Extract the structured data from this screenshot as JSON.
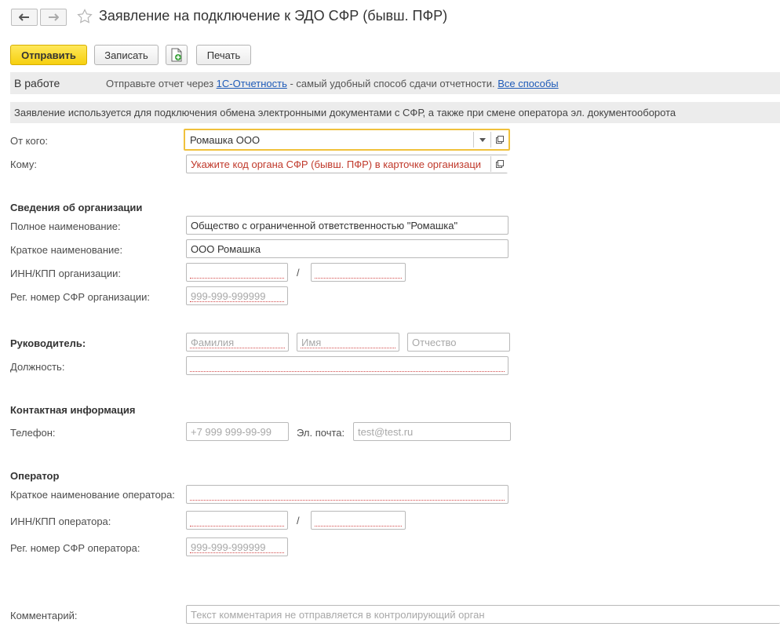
{
  "window": {
    "title": "Заявление на подключение к ЭДО СФР (бывш. ПФР)"
  },
  "toolbar": {
    "send_label": "Отправить",
    "save_label": "Записать",
    "print_label": "Печать"
  },
  "status": {
    "state": "В работе",
    "text_before": "Отправьте отчет через ",
    "link1": "1С-Отчетность",
    "text_after": " - самый удобный способ сдачи отчетности. ",
    "link2": "Все способы"
  },
  "info_text": "Заявление используется для подключения обмена электронными документами с СФР, а также при смене оператора эл. документооборота",
  "from": {
    "label": "От кого:",
    "value": "Ромашка ООО"
  },
  "to": {
    "label": "Кому:",
    "value": "Укажите код органа СФР (бывш. ПФР) в карточке организаци"
  },
  "org": {
    "heading": "Сведения об организации",
    "full_name_label": "Полное наименование:",
    "full_name_value": "Общество с ограниченной ответственностью \"Ромашка\"",
    "short_name_label": "Краткое наименование:",
    "short_name_value": "ООО Ромашка",
    "inn_kpp_label": "ИНН/КПП организации:",
    "slash": "/",
    "reg_label": "Рег. номер СФР организации:",
    "reg_placeholder": "999-999-999999"
  },
  "head": {
    "heading": "Руководитель:",
    "last_name_ph": "Фамилия",
    "first_name_ph": "Имя",
    "middle_name_ph": "Отчество",
    "position_label": "Должность:"
  },
  "contact": {
    "heading": "Контактная информация",
    "phone_label": "Телефон:",
    "phone_ph": "+7 999 999-99-99",
    "email_label": "Эл. почта:",
    "email_ph": "test@test.ru"
  },
  "operator": {
    "heading": "Оператор",
    "short_name_label": "Краткое наименование оператора:",
    "inn_kpp_label": "ИНН/КПП оператора:",
    "slash": "/",
    "reg_label": "Рег. номер СФР оператора:",
    "reg_placeholder": "999-999-999999"
  },
  "comment": {
    "label": "Комментарий:",
    "placeholder": "Текст комментария не отправляется в контролирующий орган"
  },
  "colors": {
    "accent_yellow": "#f6d00f",
    "link": "#1f5bb8",
    "error": "#c0392b",
    "band": "#ececec"
  }
}
